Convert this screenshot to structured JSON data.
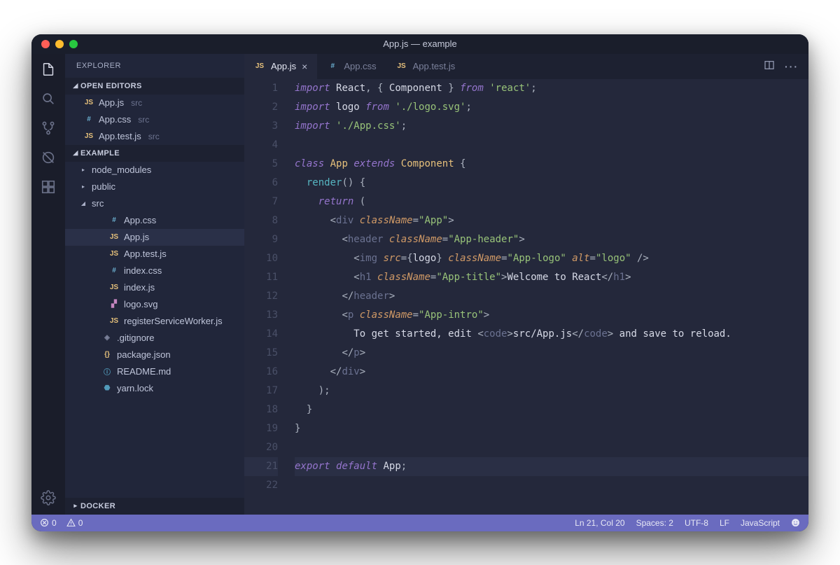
{
  "window": {
    "title": "App.js — example"
  },
  "activitybar": {
    "items": [
      "files",
      "search",
      "git",
      "debug",
      "extensions"
    ],
    "bottom": [
      "settings"
    ]
  },
  "sidebar": {
    "title": "EXPLORER",
    "openEditorsLabel": "OPEN EDITORS",
    "openEditors": [
      {
        "icon": "js",
        "name": "App.js",
        "hint": "src",
        "active": false
      },
      {
        "icon": "css",
        "name": "App.css",
        "hint": "src",
        "active": false
      },
      {
        "icon": "js",
        "name": "App.test.js",
        "hint": "src",
        "active": false
      }
    ],
    "projectLabel": "EXAMPLE",
    "tree": [
      {
        "type": "folder",
        "name": "node_modules",
        "open": false,
        "depth": 1
      },
      {
        "type": "folder",
        "name": "public",
        "open": false,
        "depth": 1
      },
      {
        "type": "folder",
        "name": "src",
        "open": true,
        "depth": 1
      },
      {
        "type": "file",
        "icon": "css",
        "name": "App.css",
        "depth": 2
      },
      {
        "type": "file",
        "icon": "js",
        "name": "App.js",
        "depth": 2,
        "active": true
      },
      {
        "type": "file",
        "icon": "js",
        "name": "App.test.js",
        "depth": 2
      },
      {
        "type": "file",
        "icon": "css",
        "name": "index.css",
        "depth": 2
      },
      {
        "type": "file",
        "icon": "js",
        "name": "index.js",
        "depth": 2
      },
      {
        "type": "file",
        "icon": "svg",
        "name": "logo.svg",
        "depth": 2
      },
      {
        "type": "file",
        "icon": "js",
        "name": "registerServiceWorker.js",
        "depth": 2
      },
      {
        "type": "file",
        "icon": "git",
        "name": ".gitignore",
        "depth": 1
      },
      {
        "type": "file",
        "icon": "json",
        "name": "package.json",
        "depth": 1
      },
      {
        "type": "file",
        "icon": "md",
        "name": "README.md",
        "depth": 1
      },
      {
        "type": "file",
        "icon": "yarn",
        "name": "yarn.lock",
        "depth": 1
      }
    ],
    "dockerLabel": "DOCKER"
  },
  "tabs": [
    {
      "icon": "js",
      "label": "App.js",
      "active": true,
      "close": true
    },
    {
      "icon": "css",
      "label": "App.css",
      "active": false,
      "close": false
    },
    {
      "icon": "js",
      "label": "App.test.js",
      "active": false,
      "close": false
    }
  ],
  "code": {
    "lines": 22,
    "hl": 21
  },
  "status": {
    "errors": "0",
    "warnings": "0",
    "position": "Ln 21, Col 20",
    "spaces": "Spaces: 2",
    "encoding": "UTF-8",
    "eol": "LF",
    "lang": "JavaScript"
  }
}
